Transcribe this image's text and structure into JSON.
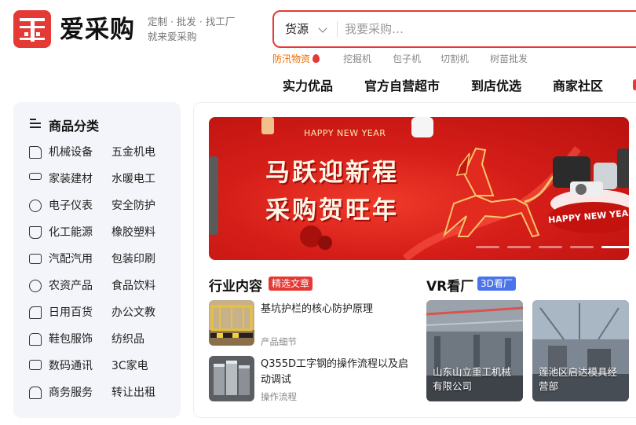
{
  "brand": {
    "name": "爱采购",
    "slogan_line1": "定制 · 批发 · 找工厂",
    "slogan_line2": "就来爱采购",
    "color": "#e53935"
  },
  "search": {
    "category": "货源",
    "placeholder": "我要采购…",
    "hot_keywords": [
      "防汛物资",
      "挖掘机",
      "包子机",
      "切割机",
      "树苗批发"
    ]
  },
  "nav": {
    "items": [
      "实力优品",
      "官方自营超市",
      "到店优选",
      "商家社区"
    ]
  },
  "sidebar": {
    "title": "商品分类",
    "categories": [
      {
        "icon": "drill-icon",
        "primary": "机械设备",
        "secondary": "五金机电"
      },
      {
        "icon": "paint-roller-icon",
        "primary": "家装建材",
        "secondary": "水暖电工"
      },
      {
        "icon": "signal-icon",
        "primary": "电子仪表",
        "secondary": "安全防护"
      },
      {
        "icon": "flask-icon",
        "primary": "化工能源",
        "secondary": "橡胶塑料"
      },
      {
        "icon": "car-parts-icon",
        "primary": "汽配汽用",
        "secondary": "包装印刷"
      },
      {
        "icon": "apple-icon",
        "primary": "农资产品",
        "secondary": "食品饮料"
      },
      {
        "icon": "tissue-icon",
        "primary": "日用百货",
        "secondary": "办公文教"
      },
      {
        "icon": "shirt-icon",
        "primary": "鞋包服饰",
        "secondary": "纺织品"
      },
      {
        "icon": "monitor-icon",
        "primary": "数码通讯",
        "secondary": "3C家电"
      },
      {
        "icon": "house-icon",
        "primary": "商务服务",
        "secondary": "转让出租"
      }
    ]
  },
  "banner": {
    "subtitle": "HAPPY NEW YEAR",
    "line1": "马跃迎新程",
    "line2": "采购贺旺年",
    "tag": "HAPPY NEW YEAR",
    "slide_count": 7,
    "active_slide": 4
  },
  "industry": {
    "title": "行业内容",
    "tag": "精选文章",
    "articles": [
      {
        "title": "基坑护栏的核心防护原理",
        "meta": "产品细节"
      },
      {
        "title": "Q355D工字钢的操作流程以及启动调试",
        "meta": "操作流程"
      }
    ]
  },
  "vr": {
    "title": "VR看厂",
    "tag": "3D看厂",
    "cards": [
      {
        "label": "山东山立重工机械有限公司"
      },
      {
        "label": "莲池区启达模具经营部"
      }
    ]
  }
}
